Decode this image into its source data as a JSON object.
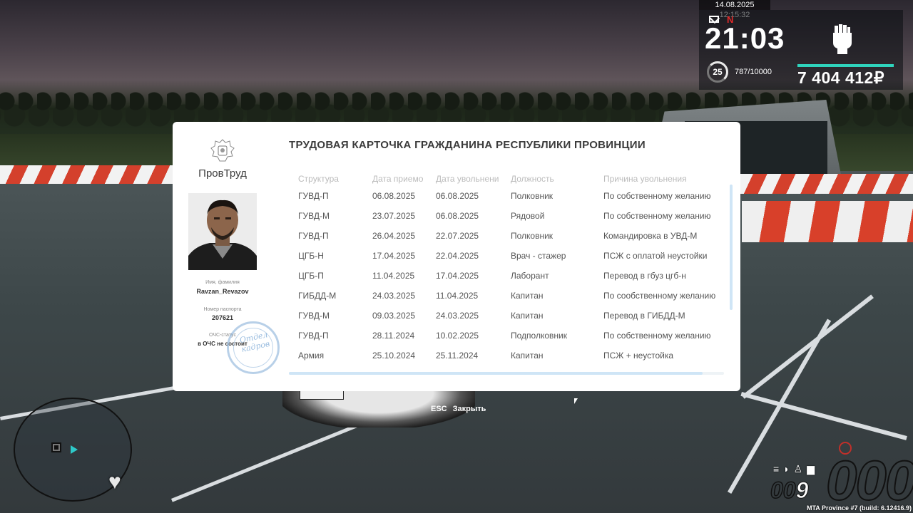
{
  "hud": {
    "date": "14.08.2025 12:15:32",
    "notification_letter": "N",
    "clock": "21:03",
    "level": "25",
    "experience": "787/10000",
    "money": "7 404 412₽",
    "bar_color": "#2fd4bd"
  },
  "card": {
    "title": "ТРУДОВАЯ КАРТОЧКА ГРАЖДАНИНА РЕСПУБЛИКИ ПРОВИНЦИИ",
    "org_name": "ПровТруд",
    "name_label": "Имя, фамилия",
    "name_value": "Ravzan_Revazov",
    "passport_label": "Номер паспорта",
    "passport_value": "207621",
    "ochs_label": "ОЧС-статус",
    "ochs_value": "в ОЧС не состоит",
    "stamp_text": "Отдел кадров",
    "columns": [
      "Структура",
      "Дата приемо",
      "Дата увольнени",
      "Должность",
      "Причина увольнения"
    ],
    "rows": [
      [
        "ГУВД-П",
        "06.08.2025",
        "06.08.2025",
        "Полковник",
        "По собственному желанию"
      ],
      [
        "ГУВД-М",
        "23.07.2025",
        "06.08.2025",
        "Рядовой",
        "По собственному желанию"
      ],
      [
        "ГУВД-П",
        "26.04.2025",
        "22.07.2025",
        "Полковник",
        "Командировка в УВД-М"
      ],
      [
        "ЦГБ-Н",
        "17.04.2025",
        "22.04.2025",
        "Врач - стажер",
        "ПСЖ с оплатой неустойки"
      ],
      [
        "ЦГБ-П",
        "11.04.2025",
        "17.04.2025",
        "Лаборант",
        "Перевод в гбуз цгб-н"
      ],
      [
        "ГИБДД-М",
        "24.03.2025",
        "11.04.2025",
        "Капитан",
        "По сообственному желанию"
      ],
      [
        "ГУВД-М",
        "09.03.2025",
        "24.03.2025",
        "Капитан",
        "Перевод в ГИБДД-М"
      ],
      [
        "ГУВД-П",
        "28.11.2024",
        "10.02.2025",
        "Подполковник",
        "По собственному желанию"
      ],
      [
        "Армия",
        "25.10.2024",
        "25.11.2024",
        "Капитан",
        "ПСЖ + неустойка"
      ]
    ]
  },
  "close_hint": {
    "key": "ESC",
    "label": "Закрыть"
  },
  "vehicle": {
    "speed": "000",
    "fuel_dim": "00",
    "fuel_cur": "9"
  },
  "build_info": "MTA Province #7 (build: 6.12416.9)"
}
